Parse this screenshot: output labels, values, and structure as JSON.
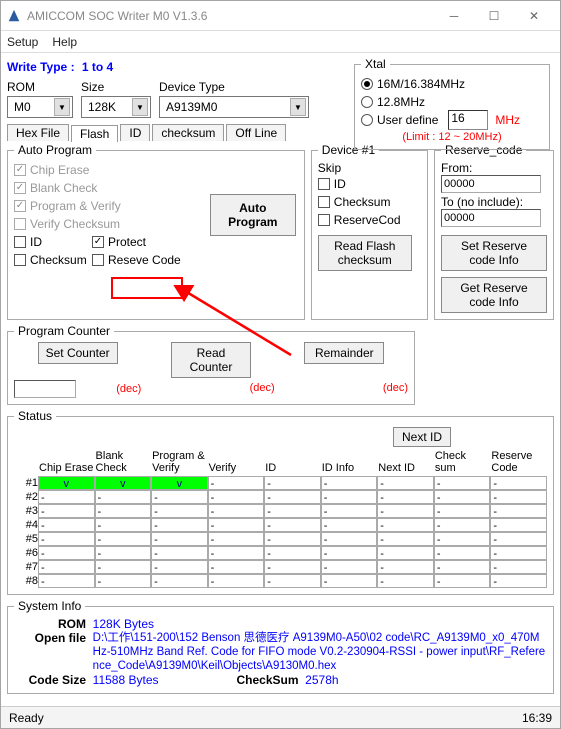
{
  "window": {
    "title": "AMICCOM SOC Writer M0 V1.3.6"
  },
  "menu": {
    "setup": "Setup",
    "help": "Help"
  },
  "write_type": {
    "label": "Write Type :",
    "value": "1 to 4"
  },
  "rom_label": "ROM",
  "rom_value": "M0",
  "size_label": "Size",
  "size_value": "128K",
  "device_type_label": "Device Type",
  "device_type_value": "A9139M0",
  "xtal": {
    "legend": "Xtal",
    "opt1": "16M/16.384MHz",
    "opt2": "12.8MHz",
    "opt3": "User define",
    "userval": "16",
    "mhz": "MHz",
    "limit": "(Limit : 12 ~ 20MHz)"
  },
  "tabs": [
    "Hex File",
    "Flash",
    "ID",
    "checksum",
    "Off Line"
  ],
  "auto": {
    "legend": "Auto Program",
    "chip_erase": "Chip Erase",
    "blank": "Blank Check",
    "pv": "Program & Verify",
    "vc": "Verify Checksum",
    "id": "ID",
    "chks": "Checksum",
    "protect": "Protect",
    "resc": "Reseve Code",
    "btn": "Auto Program"
  },
  "dev1": {
    "legend": "Device #1",
    "skip": "Skip",
    "id": "ID",
    "chk": "Checksum",
    "rc": "ReserveCod",
    "rf": "Read Flash checksum"
  },
  "res": {
    "legend": "Reserve_code",
    "from": "From:",
    "fromv": "00000",
    "to": "To (no include):",
    "tov": "00000",
    "set": "Set Reserve code Info",
    "get": "Get Reserve code Info"
  },
  "pc": {
    "legend": "Program Counter",
    "set": "Set Counter",
    "read": "Read Counter",
    "rem": "Remainder",
    "dec": "(dec)"
  },
  "status": {
    "legend": "Status",
    "next": "Next ID",
    "headers": [
      "Chip Erase",
      "Blank Check",
      "Program & Verify",
      "Verify",
      "ID",
      "ID Info",
      "Next ID",
      "Check sum",
      "Reserve Code"
    ],
    "rows": [
      "#1",
      "#2",
      "#3",
      "#4",
      "#5",
      "#6",
      "#7",
      "#8"
    ]
  },
  "sysinfo": {
    "legend": "System Info",
    "rom_k": "ROM",
    "rom_v": "128K Bytes",
    "of_k": "Open file",
    "of_v": "D:\\工作\\151-200\\152 Benson 思德医疗 A9139M0-A50\\02 code\\RC_A9139M0_x0_470MHz-510MHz Band Ref. Code for FIFO mode V0.2-230904-RSSI - power input\\RF_Reference_Code\\A9139M0\\Keil\\Objects\\A9130M0.hex",
    "cs_k": "Code Size",
    "cs_v": "11588 Bytes",
    "chk_k": "CheckSum",
    "chk_v": "2578h"
  },
  "status_bar": {
    "ready": "Ready",
    "time": "16:39"
  }
}
